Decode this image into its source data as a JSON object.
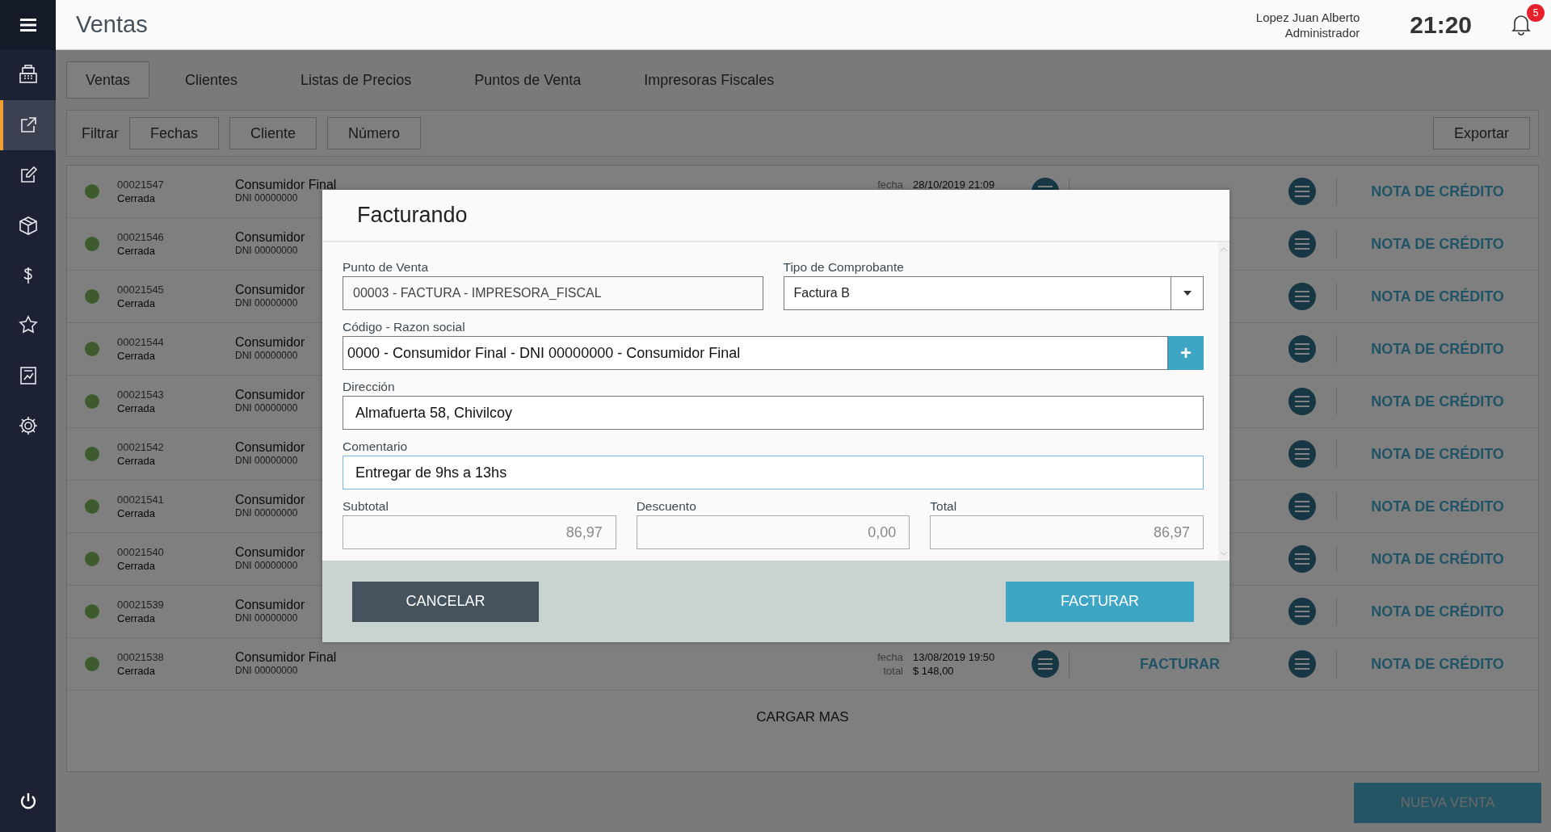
{
  "nav": [
    {
      "selected": false
    },
    {
      "selected": true
    },
    {
      "selected": false
    },
    {
      "selected": false
    },
    {
      "selected": false
    },
    {
      "selected": false
    },
    {
      "selected": false
    },
    {
      "selected": false
    }
  ],
  "header": {
    "title": "Ventas",
    "user": "Lopez Juan Alberto",
    "role": "Administrador",
    "time": "21:20",
    "notifications": "5"
  },
  "tabs": [
    {
      "label": "Ventas",
      "selected": true
    },
    {
      "label": "Clientes",
      "selected": false
    },
    {
      "label": "Listas de Precios",
      "selected": false
    },
    {
      "label": "Puntos de Venta",
      "selected": false
    },
    {
      "label": "Impresoras Fiscales",
      "selected": false
    }
  ],
  "filter": {
    "label": "Filtrar",
    "buttons": [
      "Fechas",
      "Cliente",
      "Número"
    ],
    "export": "Exportar"
  },
  "rows": [
    {
      "number": "00021547",
      "status": "Cerrada",
      "name": "Consumidor Final",
      "dni": "DNI 00000000",
      "fecha_label": "fecha",
      "fecha": "28/10/2019 21:09",
      "options": true,
      "credit": "NOTA DE CRÉDITO"
    },
    {
      "number": "00021546",
      "status": "Cerrada",
      "name": "Consumidor",
      "dni": "DNI 00000000",
      "credit": "NOTA DE CRÉDITO"
    },
    {
      "number": "00021545",
      "status": "Cerrada",
      "name": "Consumidor",
      "dni": "DNI 00000000",
      "credit": "NOTA DE CRÉDITO"
    },
    {
      "number": "00021544",
      "status": "Cerrada",
      "name": "Consumidor",
      "dni": "DNI 00000000",
      "credit": "NOTA DE CRÉDITO"
    },
    {
      "number": "00021543",
      "status": "Cerrada",
      "name": "Consumidor",
      "dni": "DNI 00000000",
      "credit": "NOTA DE CRÉDITO"
    },
    {
      "number": "00021542",
      "status": "Cerrada",
      "name": "Consumidor",
      "dni": "DNI 00000000",
      "credit": "NOTA DE CRÉDITO"
    },
    {
      "number": "00021541",
      "status": "Cerrada",
      "name": "Consumidor",
      "dni": "DNI 00000000",
      "credit": "NOTA DE CRÉDITO"
    },
    {
      "number": "00021540",
      "status": "Cerrada",
      "name": "Consumidor",
      "dni": "DNI 00000000",
      "credit": "NOTA DE CRÉDITO"
    },
    {
      "number": "00021539",
      "status": "Cerrada",
      "name": "Consumidor",
      "dni": "DNI 00000000",
      "credit": "NOTA DE CRÉDITO"
    },
    {
      "number": "00021538",
      "status": "Cerrada",
      "name": "Consumidor Final",
      "dni": "DNI 00000000",
      "fecha_label": "fecha",
      "fecha": "13/08/2019 19:50",
      "total_label": "total",
      "total": "$ 148,00",
      "options": true,
      "action": "FACTURAR",
      "credit": "NOTA DE CRÉDITO"
    }
  ],
  "load_more": "CARGAR MAS",
  "new_sale": "NUEVA VENTA",
  "modal": {
    "title": "Facturando",
    "fields": [
      {
        "label": "Punto de Venta",
        "value": "00003 - FACTURA - IMPRESORA_FISCAL",
        "kind": "readonly",
        "focused": false
      },
      {
        "label": "Tipo de Comprobante",
        "value": "Factura B",
        "kind": "select",
        "focused": false
      },
      {
        "label": "Código - Razon social",
        "value": "0000 - Consumidor Final - DNI 00000000 - Consumidor Final",
        "kind": "add",
        "add": "+",
        "focused": false
      },
      {
        "label": "Dirección",
        "value": "Almafuerta 58, Chivilcoy",
        "kind": "text",
        "focused": false
      },
      {
        "label": "Comentario",
        "value": "Entregar de 9hs a 13hs",
        "kind": "text",
        "focused": true
      }
    ],
    "totals": [
      {
        "label": "Subtotal",
        "value": "86,97",
        "disabled": true
      },
      {
        "label": "Descuento",
        "value": "0,00",
        "disabled": true
      },
      {
        "label": "Total",
        "value": "86,97",
        "disabled": true
      }
    ],
    "cancel": "CANCELAR",
    "submit": "FACTURAR"
  }
}
